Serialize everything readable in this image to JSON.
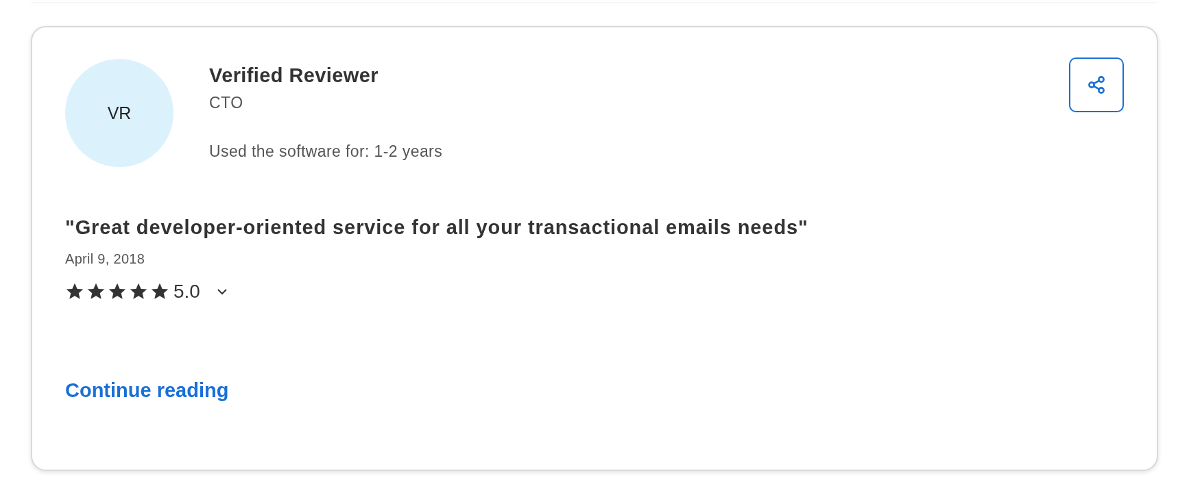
{
  "review": {
    "avatar_initials": "VR",
    "reviewer_name": "Verified Reviewer",
    "reviewer_role": "CTO",
    "usage": "Used the software for: 1-2 years",
    "title": "\"Great developer-oriented service for all your transactional emails needs\"",
    "date": "April 9, 2018",
    "stars": 5,
    "rating": "5.0",
    "expanded": false,
    "link": "Continue reading"
  }
}
